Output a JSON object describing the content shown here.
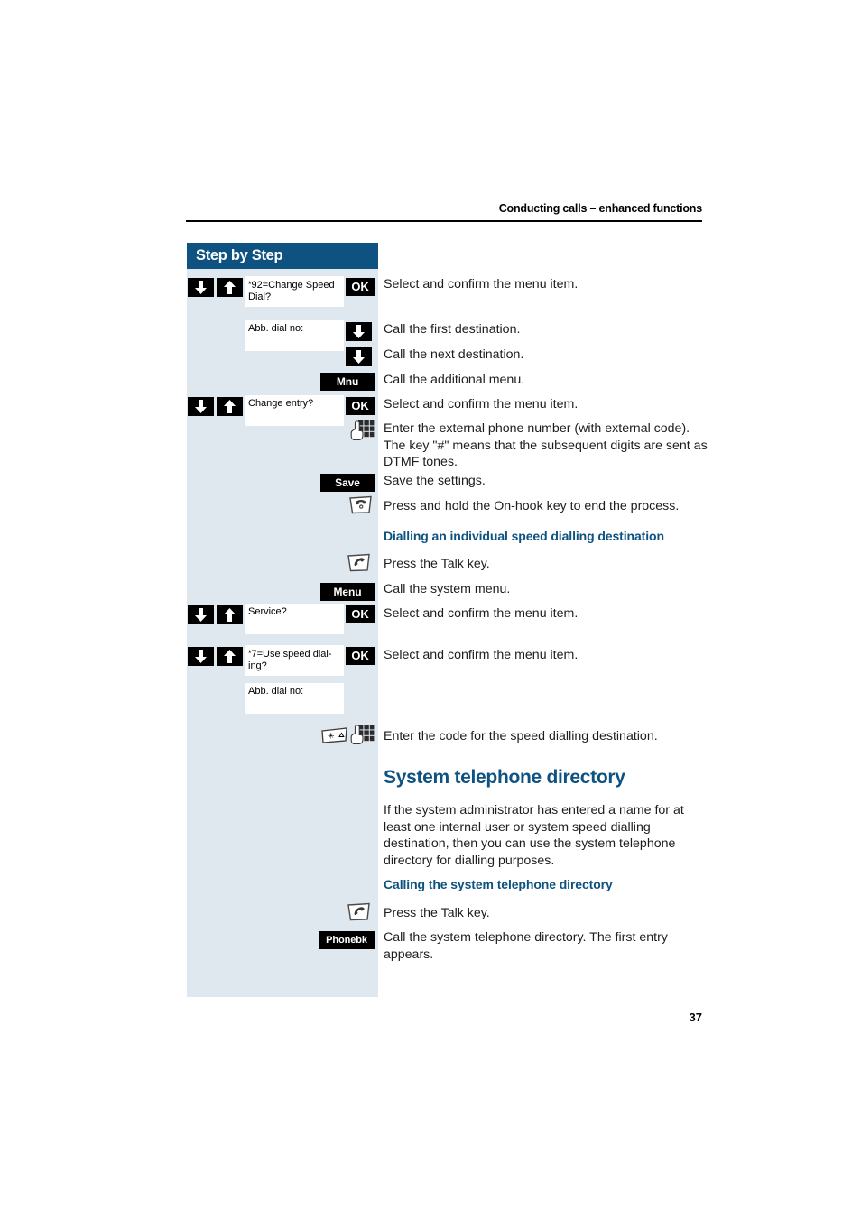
{
  "header": {
    "running_title": "Conducting calls – enhanced functions"
  },
  "sidebar": {
    "title": "Step by Step"
  },
  "page_number": "37",
  "steps": [
    {
      "id": "change-speed-dial",
      "keys": [
        "down-arrow-key",
        "up-arrow-key"
      ],
      "display": "92=Change Speed Dial?",
      "display_prefix": "*",
      "softkey": "OK",
      "text": "Select and confirm the menu item."
    },
    {
      "id": "abb-dial-no-1",
      "display": "Abb. dial no:",
      "key_icon": "down-arrow-key",
      "text": "Call the first destination."
    },
    {
      "id": "next-destination",
      "key_icon": "down-arrow-key",
      "text": "Call the next destination."
    },
    {
      "id": "additional-menu",
      "softkey": "Mnu",
      "text": "Call the additional menu."
    },
    {
      "id": "change-entry",
      "keys": [
        "down-arrow-key",
        "up-arrow-key"
      ],
      "display": "Change entry?",
      "softkey": "OK",
      "text": "Select and confirm the menu item."
    },
    {
      "id": "enter-external-number",
      "icon": "keypad-icon",
      "text": "Enter the external phone number (with external code). The key \"#\" means that the subsequent digits are sent as DTMF tones."
    },
    {
      "id": "save-settings",
      "softkey": "Save",
      "text": "Save the settings."
    },
    {
      "id": "on-hook-end",
      "icon": "on-hook-key-icon",
      "text": "Press and hold the On-hook key to end the process."
    }
  ],
  "section_dialling": {
    "heading": "Dialling an individual speed dialling destination",
    "steps": [
      {
        "id": "press-talk-key-1",
        "icon": "talk-key-icon",
        "text": "Press the Talk key."
      },
      {
        "id": "call-system-menu",
        "softkey": "Menu",
        "text": "Call the system menu."
      },
      {
        "id": "service",
        "keys": [
          "down-arrow-key",
          "up-arrow-key"
        ],
        "display": "Service?",
        "softkey": "OK",
        "text": "Select and confirm the menu item."
      },
      {
        "id": "use-speed-dialing",
        "keys": [
          "down-arrow-key",
          "up-arrow-key"
        ],
        "display": "7=Use speed dial- ing?",
        "display_prefix": "*",
        "softkey": "OK",
        "text": "Select and confirm the menu item."
      },
      {
        "id": "abb-dial-no-2",
        "display": "Abb. dial no:"
      },
      {
        "id": "enter-speed-dial-code",
        "icons": [
          "star-key-icon",
          "keypad-icon"
        ],
        "text": "Enter the code for the speed dialling destination."
      }
    ]
  },
  "section_directory": {
    "heading": "System telephone directory",
    "paragraph": "If the system administrator has entered a name for at least one internal user or system speed dialling destination, then you can use the system telephone directory for dialling purposes.",
    "subheading": "Calling the system telephone directory",
    "steps": [
      {
        "id": "press-talk-key-2",
        "icon": "talk-key-icon",
        "text": "Press the Talk key."
      },
      {
        "id": "call-phonebook",
        "softkey": "Phonebk",
        "text": "Call the system telephone directory. The first entry appears."
      }
    ]
  },
  "colors": {
    "brand_blue": "#0d5280",
    "sidebar_bg": "#dfe7ef",
    "key_black": "#000000"
  }
}
